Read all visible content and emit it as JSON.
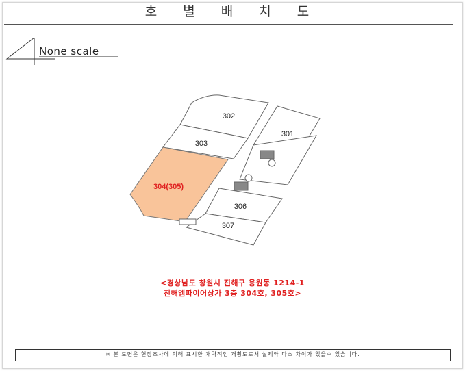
{
  "title": "호 별 배 치 도",
  "scale_label": "None scale",
  "units": {
    "u302": "302",
    "u301": "301",
    "u303": "303",
    "u304": "304(305)",
    "u306": "306",
    "u307": "307"
  },
  "highlight_color": "#f9c49a",
  "address_line1": "<경상남도 창원시 진해구 용원동 1214-1",
  "address_line2": "진해엠파이어상가 3층 304호, 305호>",
  "footnote": "※ 본 도면은 현장조사에 의해 표시한 개략적인 개황도로서 실제와 다소 차이가 있을수 있습니다."
}
